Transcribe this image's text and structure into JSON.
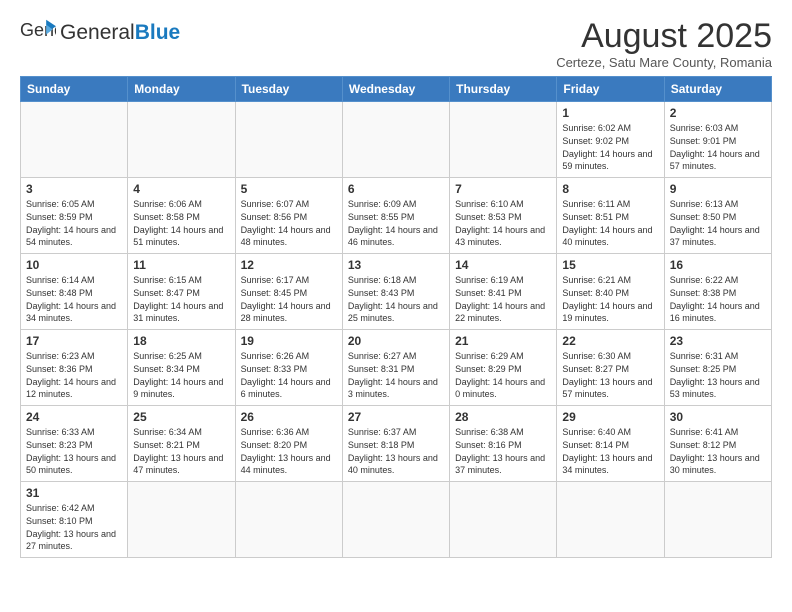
{
  "logo": {
    "text_normal": "General",
    "text_bold": "Blue"
  },
  "title": "August 2025",
  "subtitle": "Certeze, Satu Mare County, Romania",
  "weekdays": [
    "Sunday",
    "Monday",
    "Tuesday",
    "Wednesday",
    "Thursday",
    "Friday",
    "Saturday"
  ],
  "weeks": [
    [
      {
        "day": "",
        "info": ""
      },
      {
        "day": "",
        "info": ""
      },
      {
        "day": "",
        "info": ""
      },
      {
        "day": "",
        "info": ""
      },
      {
        "day": "",
        "info": ""
      },
      {
        "day": "1",
        "info": "Sunrise: 6:02 AM\nSunset: 9:02 PM\nDaylight: 14 hours and 59 minutes."
      },
      {
        "day": "2",
        "info": "Sunrise: 6:03 AM\nSunset: 9:01 PM\nDaylight: 14 hours and 57 minutes."
      }
    ],
    [
      {
        "day": "3",
        "info": "Sunrise: 6:05 AM\nSunset: 8:59 PM\nDaylight: 14 hours and 54 minutes."
      },
      {
        "day": "4",
        "info": "Sunrise: 6:06 AM\nSunset: 8:58 PM\nDaylight: 14 hours and 51 minutes."
      },
      {
        "day": "5",
        "info": "Sunrise: 6:07 AM\nSunset: 8:56 PM\nDaylight: 14 hours and 48 minutes."
      },
      {
        "day": "6",
        "info": "Sunrise: 6:09 AM\nSunset: 8:55 PM\nDaylight: 14 hours and 46 minutes."
      },
      {
        "day": "7",
        "info": "Sunrise: 6:10 AM\nSunset: 8:53 PM\nDaylight: 14 hours and 43 minutes."
      },
      {
        "day": "8",
        "info": "Sunrise: 6:11 AM\nSunset: 8:51 PM\nDaylight: 14 hours and 40 minutes."
      },
      {
        "day": "9",
        "info": "Sunrise: 6:13 AM\nSunset: 8:50 PM\nDaylight: 14 hours and 37 minutes."
      }
    ],
    [
      {
        "day": "10",
        "info": "Sunrise: 6:14 AM\nSunset: 8:48 PM\nDaylight: 14 hours and 34 minutes."
      },
      {
        "day": "11",
        "info": "Sunrise: 6:15 AM\nSunset: 8:47 PM\nDaylight: 14 hours and 31 minutes."
      },
      {
        "day": "12",
        "info": "Sunrise: 6:17 AM\nSunset: 8:45 PM\nDaylight: 14 hours and 28 minutes."
      },
      {
        "day": "13",
        "info": "Sunrise: 6:18 AM\nSunset: 8:43 PM\nDaylight: 14 hours and 25 minutes."
      },
      {
        "day": "14",
        "info": "Sunrise: 6:19 AM\nSunset: 8:41 PM\nDaylight: 14 hours and 22 minutes."
      },
      {
        "day": "15",
        "info": "Sunrise: 6:21 AM\nSunset: 8:40 PM\nDaylight: 14 hours and 19 minutes."
      },
      {
        "day": "16",
        "info": "Sunrise: 6:22 AM\nSunset: 8:38 PM\nDaylight: 14 hours and 16 minutes."
      }
    ],
    [
      {
        "day": "17",
        "info": "Sunrise: 6:23 AM\nSunset: 8:36 PM\nDaylight: 14 hours and 12 minutes."
      },
      {
        "day": "18",
        "info": "Sunrise: 6:25 AM\nSunset: 8:34 PM\nDaylight: 14 hours and 9 minutes."
      },
      {
        "day": "19",
        "info": "Sunrise: 6:26 AM\nSunset: 8:33 PM\nDaylight: 14 hours and 6 minutes."
      },
      {
        "day": "20",
        "info": "Sunrise: 6:27 AM\nSunset: 8:31 PM\nDaylight: 14 hours and 3 minutes."
      },
      {
        "day": "21",
        "info": "Sunrise: 6:29 AM\nSunset: 8:29 PM\nDaylight: 14 hours and 0 minutes."
      },
      {
        "day": "22",
        "info": "Sunrise: 6:30 AM\nSunset: 8:27 PM\nDaylight: 13 hours and 57 minutes."
      },
      {
        "day": "23",
        "info": "Sunrise: 6:31 AM\nSunset: 8:25 PM\nDaylight: 13 hours and 53 minutes."
      }
    ],
    [
      {
        "day": "24",
        "info": "Sunrise: 6:33 AM\nSunset: 8:23 PM\nDaylight: 13 hours and 50 minutes."
      },
      {
        "day": "25",
        "info": "Sunrise: 6:34 AM\nSunset: 8:21 PM\nDaylight: 13 hours and 47 minutes."
      },
      {
        "day": "26",
        "info": "Sunrise: 6:36 AM\nSunset: 8:20 PM\nDaylight: 13 hours and 44 minutes."
      },
      {
        "day": "27",
        "info": "Sunrise: 6:37 AM\nSunset: 8:18 PM\nDaylight: 13 hours and 40 minutes."
      },
      {
        "day": "28",
        "info": "Sunrise: 6:38 AM\nSunset: 8:16 PM\nDaylight: 13 hours and 37 minutes."
      },
      {
        "day": "29",
        "info": "Sunrise: 6:40 AM\nSunset: 8:14 PM\nDaylight: 13 hours and 34 minutes."
      },
      {
        "day": "30",
        "info": "Sunrise: 6:41 AM\nSunset: 8:12 PM\nDaylight: 13 hours and 30 minutes."
      }
    ],
    [
      {
        "day": "31",
        "info": "Sunrise: 6:42 AM\nSunset: 8:10 PM\nDaylight: 13 hours and 27 minutes."
      },
      {
        "day": "",
        "info": ""
      },
      {
        "day": "",
        "info": ""
      },
      {
        "day": "",
        "info": ""
      },
      {
        "day": "",
        "info": ""
      },
      {
        "day": "",
        "info": ""
      },
      {
        "day": "",
        "info": ""
      }
    ]
  ]
}
